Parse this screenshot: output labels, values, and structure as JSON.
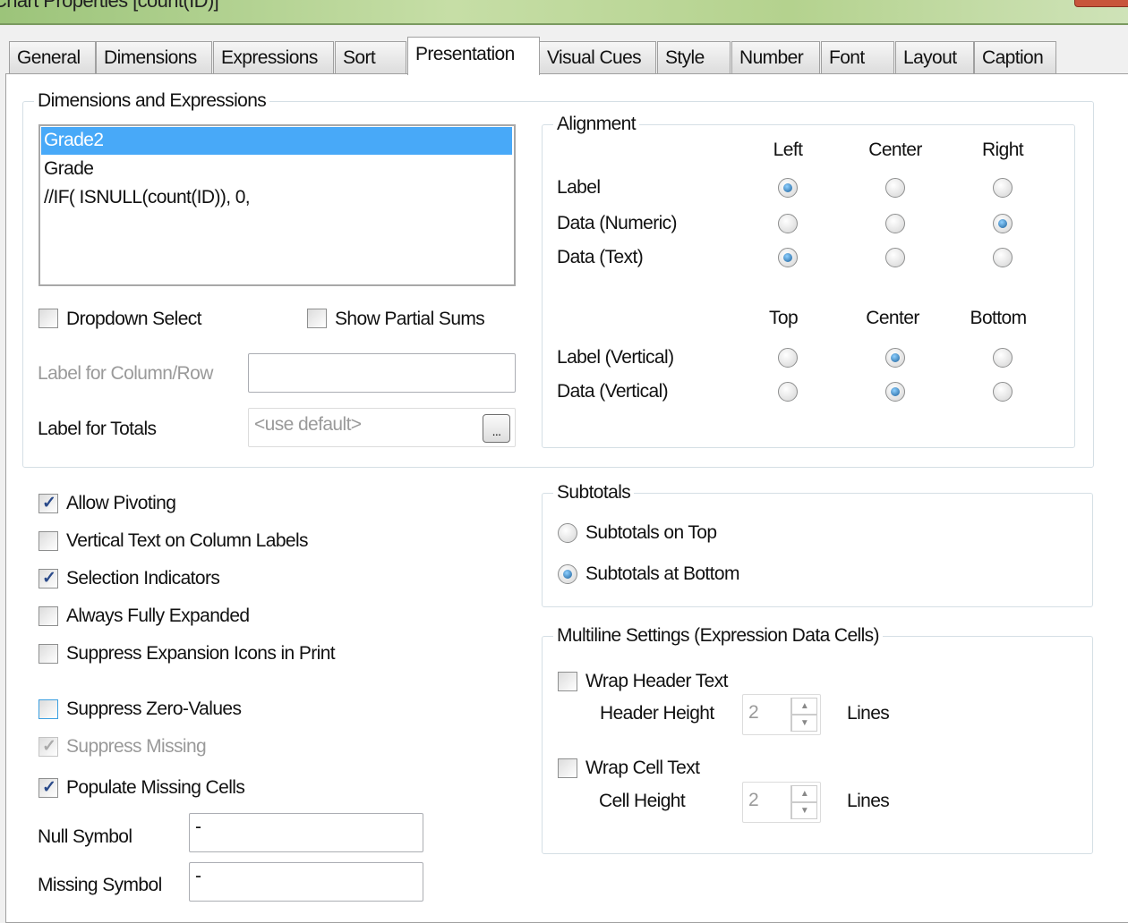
{
  "window": {
    "title": "Chart Properties [count(ID)]"
  },
  "tabs": [
    "General",
    "Dimensions",
    "Expressions",
    "Sort",
    "Presentation",
    "Visual Cues",
    "Style",
    "Number",
    "Font",
    "Layout",
    "Caption"
  ],
  "active_tab": "Presentation",
  "dims": {
    "title": "Dimensions and Expressions",
    "items": [
      "Grade2",
      "Grade",
      "//IF( ISNULL(count(ID)), 0,"
    ],
    "selected": "Grade2",
    "dropdown_select": "Dropdown Select",
    "show_partial_sums": "Show Partial Sums",
    "label_col_row": "Label for Column/Row",
    "label_col_row_value": "",
    "label_totals": "Label for Totals",
    "label_totals_placeholder": "<use default>",
    "browse": "..."
  },
  "alignment": {
    "title": "Alignment",
    "h_cols": [
      "Left",
      "Center",
      "Right"
    ],
    "v_cols": [
      "Top",
      "Center",
      "Bottom"
    ],
    "rows": [
      {
        "label": "Label",
        "selected": "Left"
      },
      {
        "label": "Data (Numeric)",
        "selected": "Right"
      },
      {
        "label": "Data (Text)",
        "selected": "Left"
      }
    ],
    "vrows": [
      {
        "label": "Label (Vertical)",
        "selected": "Center"
      },
      {
        "label": "Data (Vertical)",
        "selected": "Center"
      }
    ]
  },
  "options": [
    {
      "label": "Allow Pivoting",
      "checked": true
    },
    {
      "label": "Vertical Text on Column Labels",
      "checked": false
    },
    {
      "label": "Selection Indicators",
      "checked": true
    },
    {
      "label": "Always Fully Expanded",
      "checked": false
    },
    {
      "label": "Suppress Expansion Icons in Print",
      "checked": false
    },
    {
      "label": "Suppress Zero-Values",
      "checked": false
    },
    {
      "label": "Suppress Missing",
      "checked": true,
      "disabled": true
    },
    {
      "label": "Populate Missing Cells",
      "checked": true
    }
  ],
  "null_symbol": {
    "label": "Null Symbol",
    "value": "-"
  },
  "missing_symbol": {
    "label": "Missing Symbol",
    "value": "-"
  },
  "subtotals": {
    "title": "Subtotals",
    "options": [
      "Subtotals on Top",
      "Subtotals at Bottom"
    ],
    "selected": "Subtotals at Bottom"
  },
  "multiline": {
    "title": "Multiline Settings (Expression Data Cells)",
    "wrap_header": "Wrap Header Text",
    "header_height": "Header Height",
    "header_value": "2",
    "wrap_cell": "Wrap Cell Text",
    "cell_height": "Cell Height",
    "cell_value": "2",
    "lines": "Lines"
  }
}
